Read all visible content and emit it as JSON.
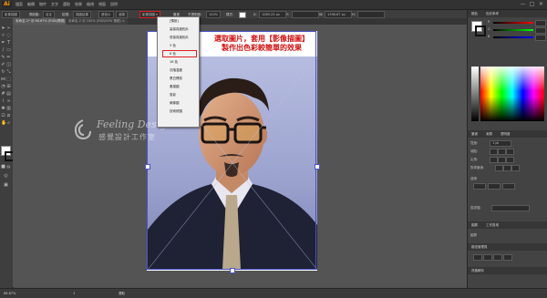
{
  "app": {
    "logo": "Ai"
  },
  "menubar": {
    "items": [
      "檔案",
      "編輯",
      "物件",
      "文字",
      "選取",
      "效果",
      "檢視",
      "視窗",
      "說明"
    ],
    "window_controls": [
      "—",
      "□",
      "✕"
    ]
  },
  "control_bar": {
    "items": [
      "影像描圖",
      "預設集:",
      "自定",
      "檢視:",
      "描圖結果",
      "遮色片",
      "追蹤",
      "筆畫",
      "不透明度:",
      "100%",
      "樣式:"
    ],
    "trace_preset_value": "影像描圖",
    "extra": [
      "X:",
      "Y:",
      "W:",
      "H:"
    ],
    "x_value": "1089.25 px",
    "w_value": "1396.67 px"
  },
  "tabs": [
    {
      "label": "未命名-1* @ 66.67% (RGB/預視) ×"
    },
    {
      "label": "未命名-2 @ 100% (RGB/GPU 預視) ×"
    }
  ],
  "dropdown": {
    "items": [
      "[預設]",
      "高保真度相片",
      "低保真度相片",
      "3 色",
      "6 色",
      "16 色",
      "灰階濃度",
      "黑白標誌",
      "素描圖",
      "剪影",
      "線條圖",
      "技術繪圖"
    ],
    "highlighted": "6 色"
  },
  "annotation": {
    "line1": "選取圖片，套用【影像描圖】",
    "line2": "製作出色彩較簡單的效果"
  },
  "watermark": {
    "line1": "Feeling Design",
    "line2": "感覺設計工作室"
  },
  "panel": {
    "color_tabs": [
      "顏色",
      "色彩參考"
    ],
    "channels": [
      "R",
      "G",
      "B"
    ],
    "channel_values": [
      "",
      "",
      ""
    ],
    "stroke_tabs": [
      "筆畫",
      "漸層",
      "透明度"
    ],
    "stroke_label": "寬度:",
    "stroke_value": "1 pt",
    "rows": [
      "端點:",
      "尖角:",
      "對齊筆畫:"
    ],
    "dash_label": "虛線",
    "profile_label": "描述檔:",
    "layers_tabs": [
      "圖層",
      "工作區域"
    ],
    "layers_label": "圖層",
    "align_label": "路徑管理員",
    "asset_label": "資產轉存"
  },
  "statusbar": {
    "zoom": "66.67%",
    "page": "1",
    "mode": "選取"
  },
  "colors": {
    "accent_red": "#e02020",
    "artboard_frame": "#4a52c8",
    "logo_orange": "#ff9a00"
  }
}
